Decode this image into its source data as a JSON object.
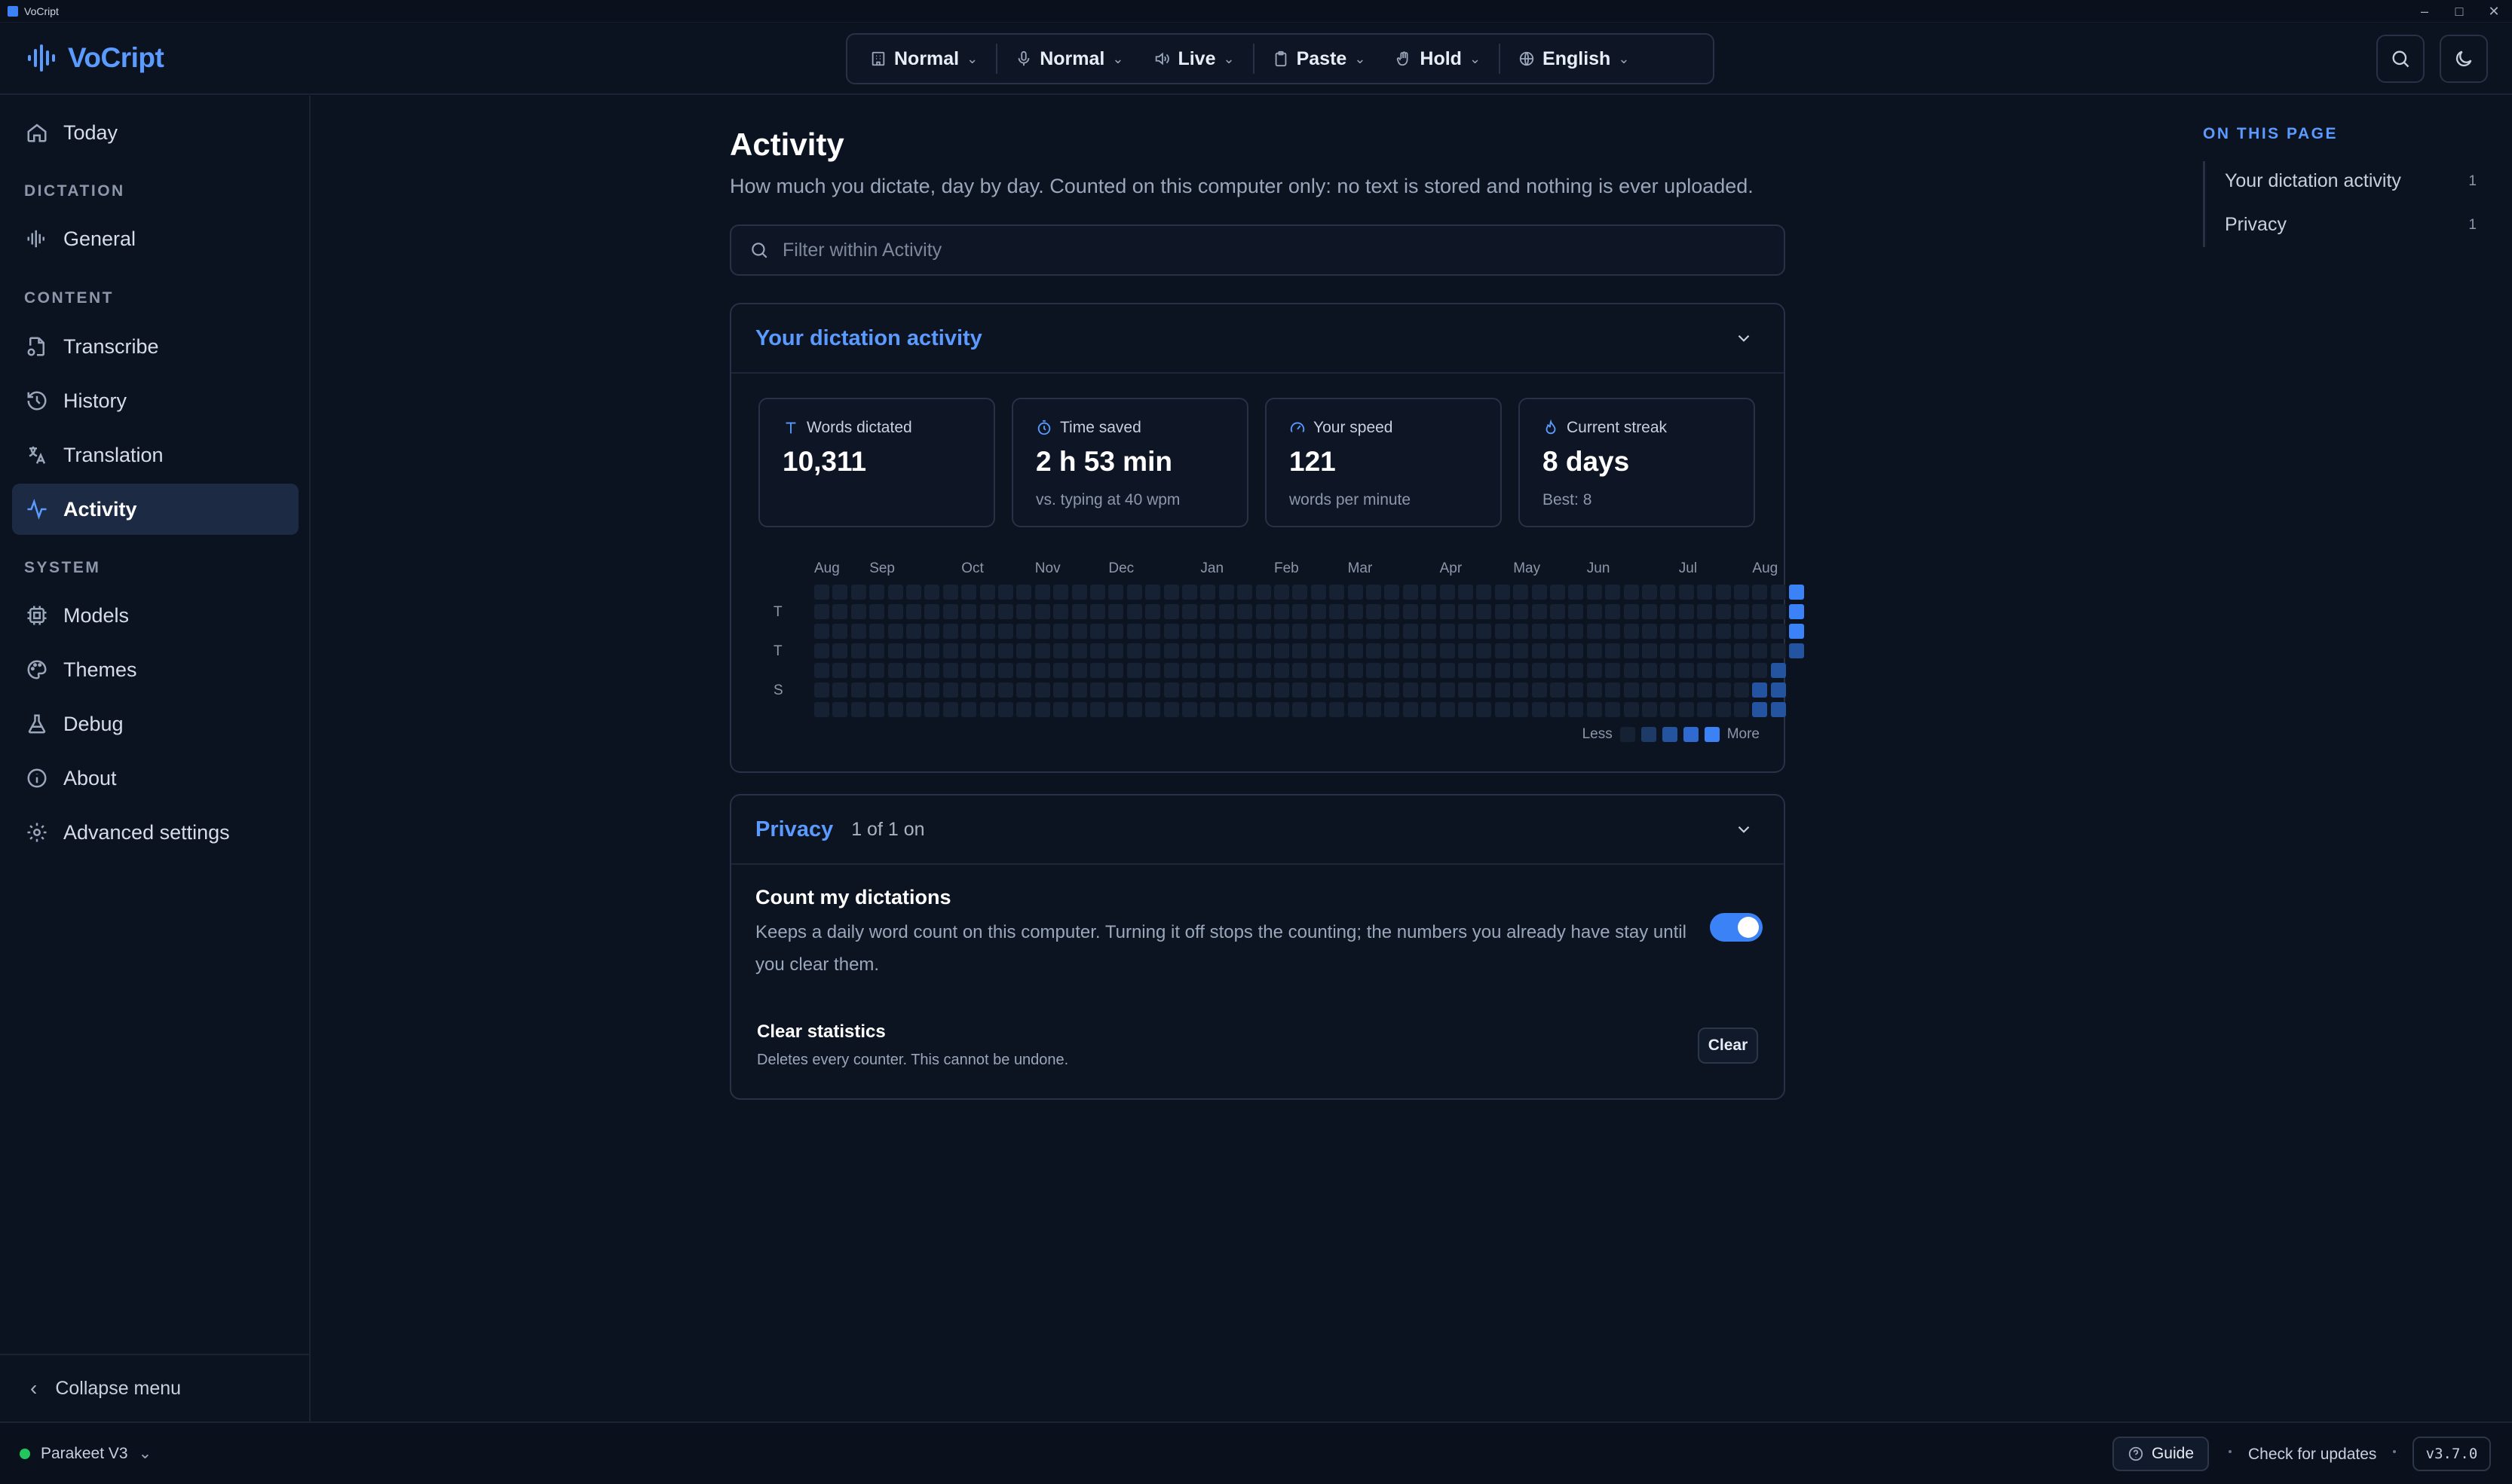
{
  "window": {
    "title": "VoCript",
    "minimize": "–",
    "maximize": "□",
    "close": "✕"
  },
  "header": {
    "app_name": "VoCript",
    "toolbar": [
      {
        "icon": "building-icon",
        "label": "Normal"
      },
      {
        "icon": "microphone-icon",
        "label": "Normal"
      },
      {
        "icon": "speaker-icon",
        "label": "Live"
      },
      {
        "icon": "clipboard-icon",
        "label": "Paste"
      },
      {
        "icon": "hand-icon",
        "label": "Hold"
      },
      {
        "icon": "globe-icon",
        "label": "English"
      }
    ]
  },
  "sidebar": {
    "today": "Today",
    "sections": {
      "dictation": "DICTATION",
      "content": "CONTENT",
      "system": "SYSTEM"
    },
    "items": {
      "general": "General",
      "transcribe": "Transcribe",
      "history": "History",
      "translation": "Translation",
      "activity": "Activity",
      "models": "Models",
      "themes": "Themes",
      "debug": "Debug",
      "about": "About",
      "advanced": "Advanced settings"
    },
    "active": "Activity",
    "collapse": "Collapse menu"
  },
  "main": {
    "title": "Activity",
    "subtitle": "How much you dictate, day by day. Counted on this computer only: no text is stored and nothing is ever uploaded.",
    "filter_placeholder": "Filter within Activity",
    "activity_card": {
      "title": "Your dictation activity",
      "stats": [
        {
          "icon": "text-icon",
          "label": "Words dictated",
          "value": "10,311",
          "note": ""
        },
        {
          "icon": "timer-icon",
          "label": "Time saved",
          "value": "2 h 53 min",
          "note": "vs. typing at 40 wpm"
        },
        {
          "icon": "gauge-icon",
          "label": "Your speed",
          "value": "121",
          "note": "words per minute"
        },
        {
          "icon": "flame-icon",
          "label": "Current streak",
          "value": "8 days",
          "note": "Best: 8"
        }
      ],
      "heatmap": {
        "months": [
          "Aug",
          "Sep",
          "Oct",
          "Nov",
          "Dec",
          "Jan",
          "Feb",
          "Mar",
          "Apr",
          "May",
          "Jun",
          "Jul",
          "Aug"
        ],
        "day_labels": [
          "",
          "T",
          "",
          "T",
          "",
          "S",
          ""
        ],
        "weeks": 53,
        "active_days": [
          {
            "week": 51,
            "day": 5,
            "level": 2
          },
          {
            "week": 51,
            "day": 6,
            "level": 2
          },
          {
            "week": 52,
            "day": 4,
            "level": 2
          },
          {
            "week": 52,
            "day": 5,
            "level": 2
          },
          {
            "week": 52,
            "day": 6,
            "level": 2
          },
          {
            "week": 53,
            "day": 0,
            "level": 4
          },
          {
            "week": 53,
            "day": 1,
            "level": 4
          },
          {
            "week": 53,
            "day": 2,
            "level": 4
          },
          {
            "week": 53,
            "day": 3,
            "level": 2
          }
        ],
        "legend_less": "Less",
        "legend_more": "More",
        "level_colors": [
          "#172134",
          "#1e3a66",
          "#2453a0",
          "#2f6ad0",
          "#3b82f6"
        ]
      }
    },
    "privacy_card": {
      "title": "Privacy",
      "count": "1 of 1 on",
      "count_setting": {
        "title": "Count my dictations",
        "description": "Keeps a daily word count on this computer. Turning it off stops the counting; the numbers you already have stay until you clear them.",
        "enabled": true
      },
      "clear_setting": {
        "title": "Clear statistics",
        "description": "Deletes every counter. This cannot be undone.",
        "button": "Clear"
      }
    }
  },
  "on_this_page": {
    "heading": "ON THIS PAGE",
    "items": [
      {
        "label": "Your dictation activity",
        "count": "1"
      },
      {
        "label": "Privacy",
        "count": "1"
      }
    ]
  },
  "statusbar": {
    "model": "Parakeet V3",
    "guide": "Guide",
    "updates": "Check for updates",
    "version": "v3.7.0"
  }
}
